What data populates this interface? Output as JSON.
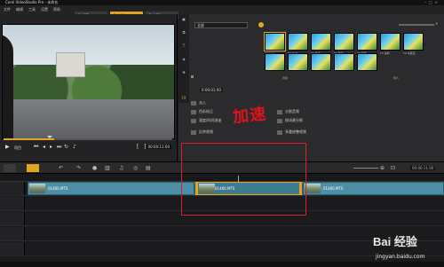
{
  "title": "Corel VideoStudio Pro - 未命名",
  "menu": [
    "文件",
    "编辑",
    "工具",
    "设置",
    "帮助"
  ],
  "steps": [
    {
      "num": "1",
      "label": "捕获"
    },
    {
      "num": "2",
      "label": "编辑"
    },
    {
      "num": "3",
      "label": "分享"
    }
  ],
  "preview": {
    "timecode": "00:00:11:00",
    "mode_a": "项目",
    "mode_b": "素材"
  },
  "library": {
    "gallery": "全部",
    "duration": "0:00:01:00",
    "tab_a": "视频",
    "tab_b": "照片",
    "fx_label": "FX",
    "thumbs": [
      "Color S",
      "Flash B",
      "FX 噪点",
      "FX 油墨",
      "FX 画笔",
      "FX 涂鸦",
      "FX 马赛克",
      "FX 漫画",
      "FX 水彩",
      "FX 旧影",
      "Soft Focus",
      "FX 球面"
    ]
  },
  "options": [
    "淡入",
    "淡出",
    "旋转",
    "色彩校正",
    "速度/时间流逝",
    "反转视频",
    "分割音频",
    "按场景分割",
    "多重修整视频"
  ],
  "annotation": "加速",
  "timeline": {
    "clips": [
      "01460.MTS",
      "01460.MTS",
      "01460.MTS"
    ]
  },
  "watermark": {
    "brand": "Bai 经验",
    "url": "jingyan.baidu.com"
  }
}
